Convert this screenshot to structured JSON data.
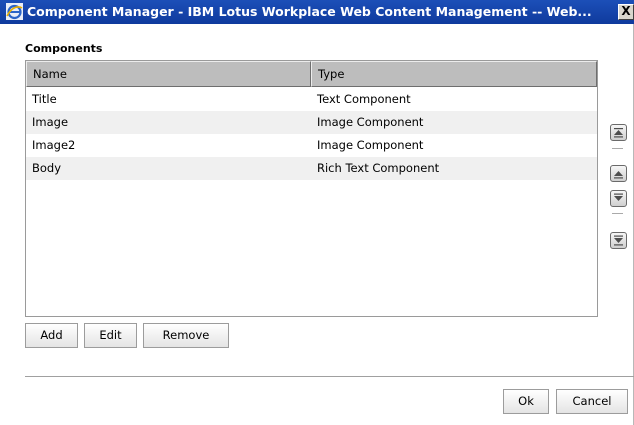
{
  "window": {
    "title": "Component Manager - IBM Lotus Workplace Web Content Management -- Web...",
    "close_glyph": "X"
  },
  "components": {
    "label": "Components",
    "columns": [
      "Name",
      "Type"
    ],
    "rows": [
      {
        "name": "Title",
        "type": "Text Component"
      },
      {
        "name": "Image",
        "type": "Image Component"
      },
      {
        "name": "Image2",
        "type": "Image Component"
      },
      {
        "name": "Body",
        "type": "Rich Text Component"
      }
    ]
  },
  "side_controls": [
    "move-top-icon",
    "move-up-icon",
    "move-down-icon",
    "move-bottom-icon"
  ],
  "actions": {
    "add": "Add",
    "edit": "Edit",
    "remove": "Remove"
  },
  "footer": {
    "ok": "Ok",
    "cancel": "Cancel"
  },
  "colors": {
    "titlebar": "#0f3a9d",
    "header_bg": "#bdbdbd",
    "alt_row": "#f0f0f0"
  }
}
